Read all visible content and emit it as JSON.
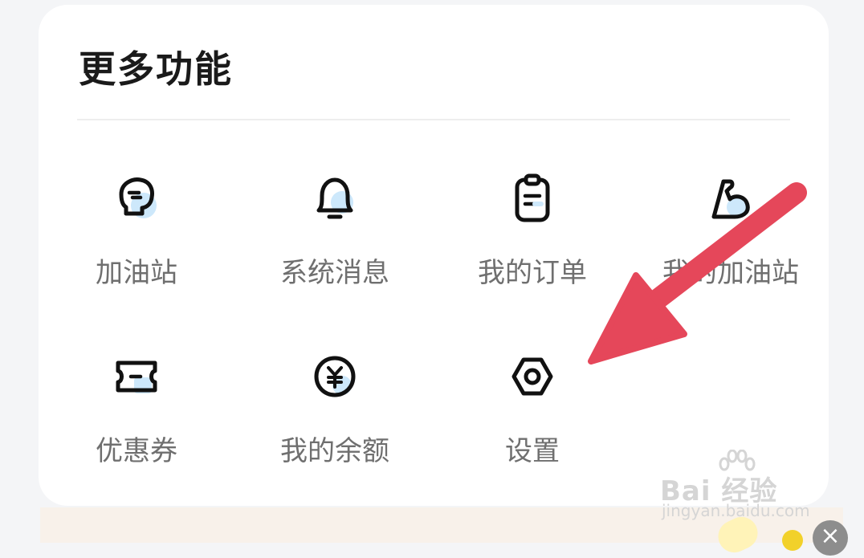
{
  "card": {
    "title": "更多功能"
  },
  "items": [
    {
      "label": "加油站",
      "icon": "glove-icon"
    },
    {
      "label": "系统消息",
      "icon": "bell-icon"
    },
    {
      "label": "我的订单",
      "icon": "clipboard-icon"
    },
    {
      "label": "我的加油站",
      "icon": "arm-icon"
    },
    {
      "label": "优惠券",
      "icon": "coupon-icon"
    },
    {
      "label": "我的余额",
      "icon": "yuan-coin-icon"
    },
    {
      "label": "设置",
      "icon": "settings-icon"
    }
  ],
  "watermark": {
    "logo": "Bai 经验",
    "url": "jingyan.baidu.com"
  },
  "bottom_bar": {
    "close": "×"
  },
  "colors": {
    "accent_blue": "#cde8fb",
    "arrow_red": "#e5475a",
    "icon_stroke": "#111111",
    "label_gray": "#6f6f6f"
  }
}
